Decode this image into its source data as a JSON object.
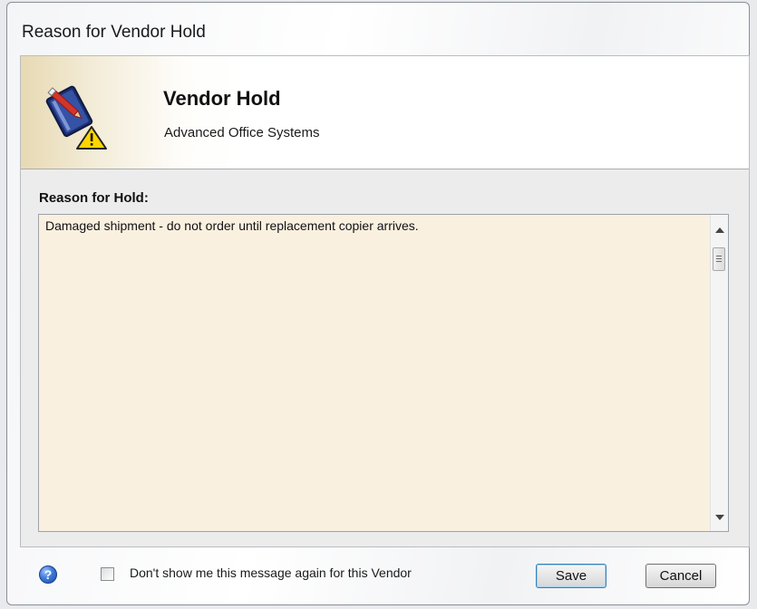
{
  "window": {
    "title": "Reason for Vendor Hold"
  },
  "header": {
    "icon": "vendor-hold-warning-icon",
    "title": "Vendor Hold",
    "subtitle": "Advanced Office Systems"
  },
  "reason": {
    "label": "Reason for Hold:",
    "text": "Damaged shipment - do not order until replacement copier arrives."
  },
  "footer": {
    "help_icon": "help-icon",
    "checkbox_label": "Don't show me this message again for this Vendor",
    "checkbox_checked": false,
    "save_label": "Save",
    "cancel_label": "Cancel"
  },
  "colors": {
    "reason_background": "#faf0e0",
    "header_gradient_start": "#e7d9b3",
    "default_button_border": "#3c7fb1"
  }
}
